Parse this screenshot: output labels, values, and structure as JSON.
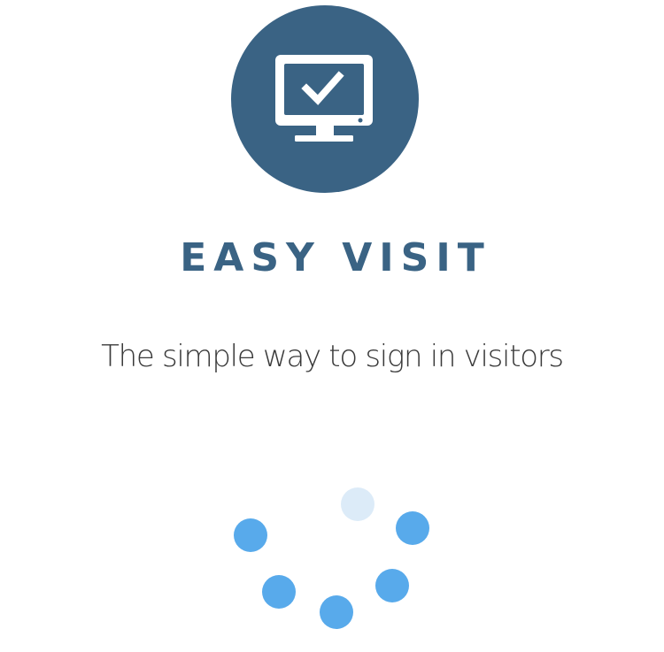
{
  "app": {
    "title": "EASY VISIT",
    "tagline": "The simple way to sign in visitors"
  },
  "logo": {
    "icon": "monitor-checkmark-icon",
    "background_color": "#3a6384",
    "icon_color": "#ffffff"
  },
  "loading": {
    "indicator": "dot-spinner",
    "dot_count": 6,
    "active_color": "#58aaeb",
    "faint_color": "#dcebf8"
  },
  "colors": {
    "title": "#3a6384",
    "tagline": "#3a3a3a",
    "background": "#ffffff"
  }
}
